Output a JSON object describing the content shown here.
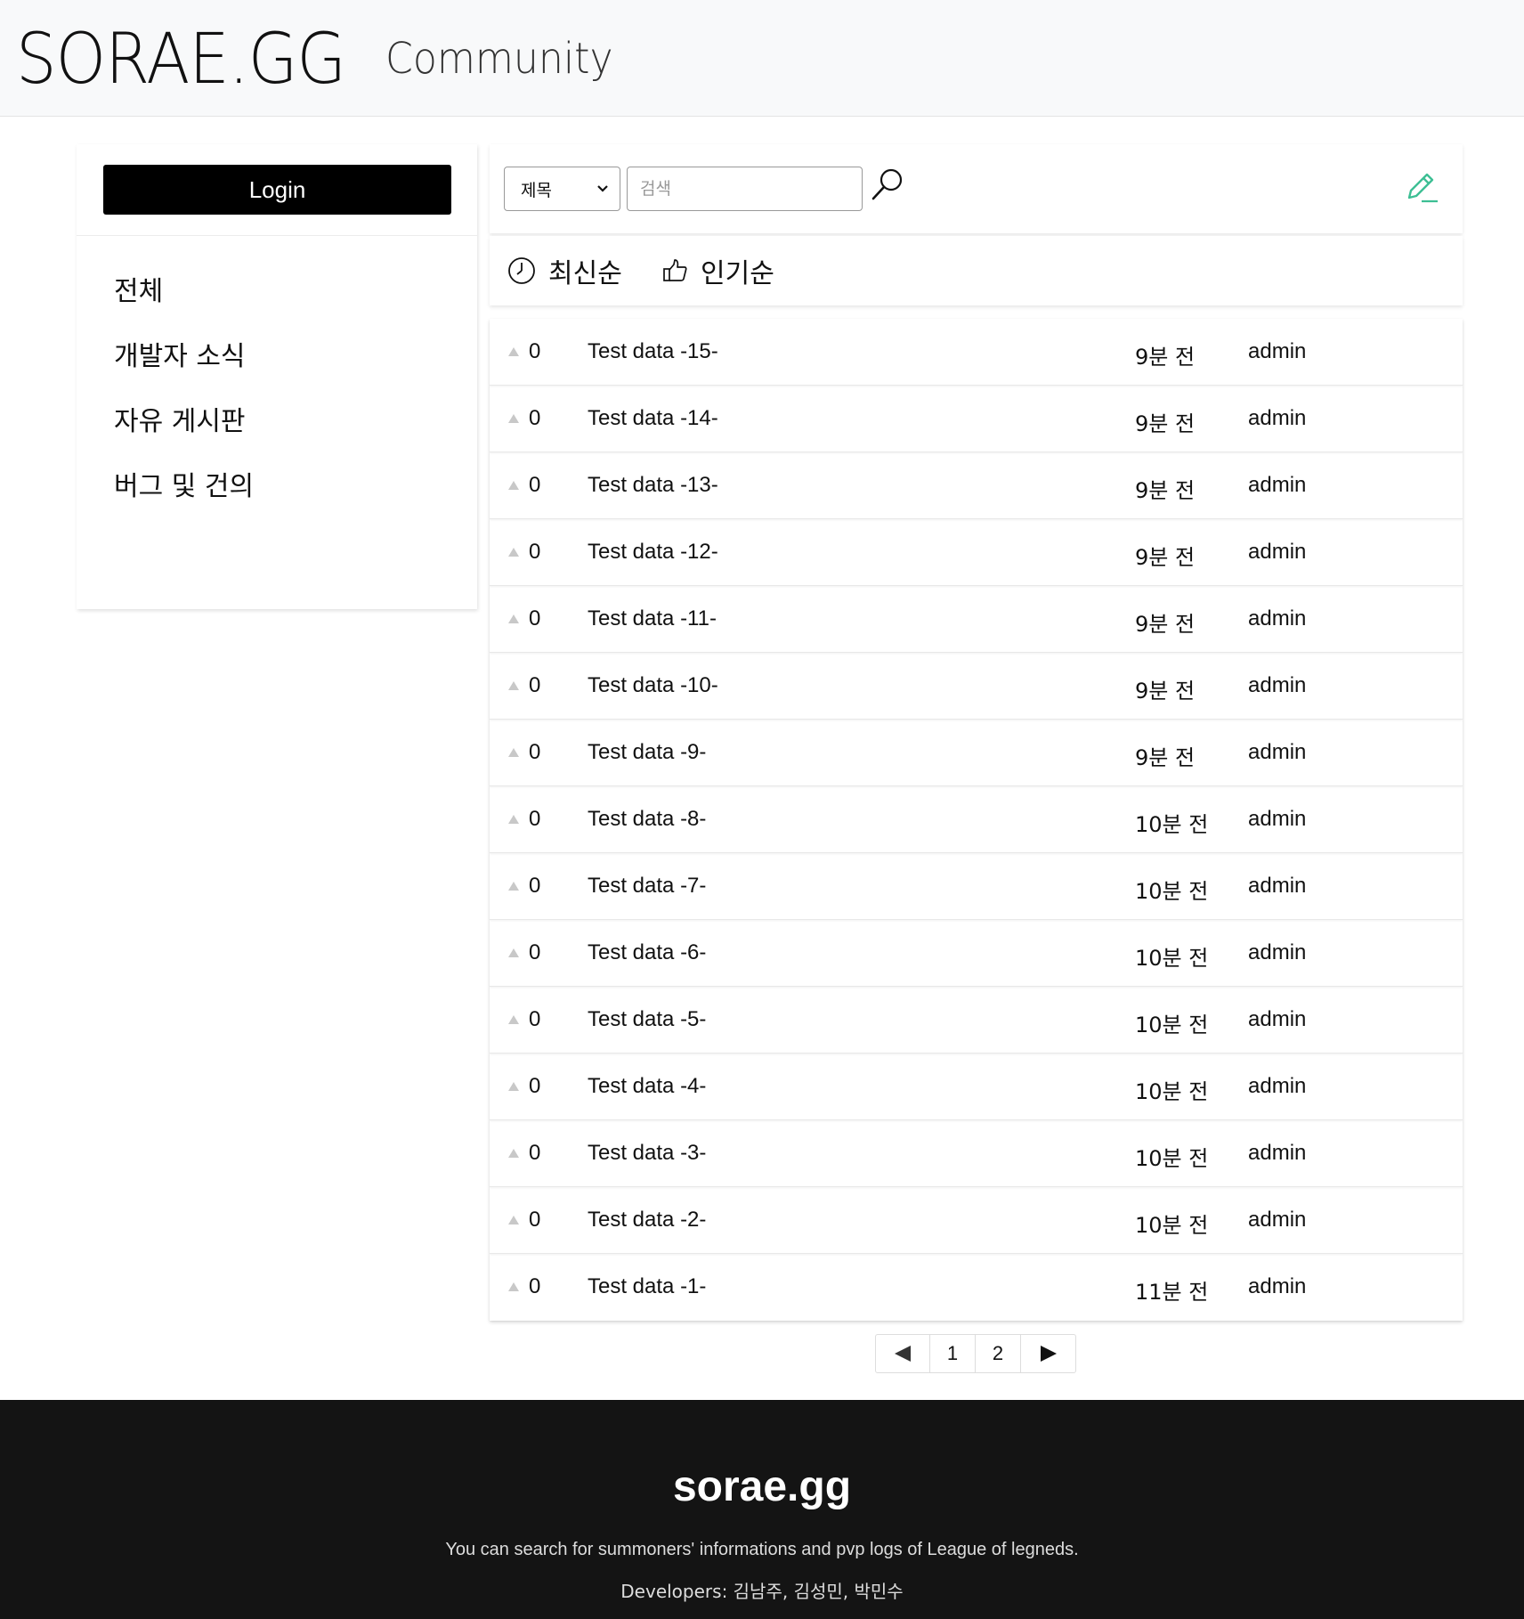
{
  "header": {
    "brand": "SORAE.GG",
    "section": "Community"
  },
  "sidebar": {
    "login_label": "Login",
    "items": [
      {
        "label": "전체"
      },
      {
        "label": "개발자 소식"
      },
      {
        "label": "자유 게시판"
      },
      {
        "label": "버그 및 건의"
      }
    ]
  },
  "search": {
    "field_selected": "제목",
    "placeholder": "검색",
    "value": ""
  },
  "sort": {
    "latest_label": "최신순",
    "popular_label": "인기순"
  },
  "colors": {
    "accent": "#3dbf94",
    "footer_bg": "#141414"
  },
  "posts": [
    {
      "votes": "0",
      "title": "Test data -15-",
      "time": "9분 전",
      "author": "admin"
    },
    {
      "votes": "0",
      "title": "Test data -14-",
      "time": "9분 전",
      "author": "admin"
    },
    {
      "votes": "0",
      "title": "Test data -13-",
      "time": "9분 전",
      "author": "admin"
    },
    {
      "votes": "0",
      "title": "Test data -12-",
      "time": "9분 전",
      "author": "admin"
    },
    {
      "votes": "0",
      "title": "Test data -11-",
      "time": "9분 전",
      "author": "admin"
    },
    {
      "votes": "0",
      "title": "Test data -10-",
      "time": "9분 전",
      "author": "admin"
    },
    {
      "votes": "0",
      "title": "Test data -9-",
      "time": "9분 전",
      "author": "admin"
    },
    {
      "votes": "0",
      "title": "Test data -8-",
      "time": "10분 전",
      "author": "admin"
    },
    {
      "votes": "0",
      "title": "Test data -7-",
      "time": "10분 전",
      "author": "admin"
    },
    {
      "votes": "0",
      "title": "Test data -6-",
      "time": "10분 전",
      "author": "admin"
    },
    {
      "votes": "0",
      "title": "Test data -5-",
      "time": "10분 전",
      "author": "admin"
    },
    {
      "votes": "0",
      "title": "Test data -4-",
      "time": "10분 전",
      "author": "admin"
    },
    {
      "votes": "0",
      "title": "Test data -3-",
      "time": "10분 전",
      "author": "admin"
    },
    {
      "votes": "0",
      "title": "Test data -2-",
      "time": "10분 전",
      "author": "admin"
    },
    {
      "votes": "0",
      "title": "Test data -1-",
      "time": "11분 전",
      "author": "admin"
    }
  ],
  "pagination": {
    "pages": [
      "1",
      "2"
    ],
    "prev_icon": "triangle-left-icon",
    "next_icon": "triangle-right-icon"
  },
  "footer": {
    "title": "sorae.gg",
    "description": "You can search for summoners' informations and pvp logs of League of legneds.",
    "developers": "Developers: 김남주, 김성민, 박민수"
  }
}
